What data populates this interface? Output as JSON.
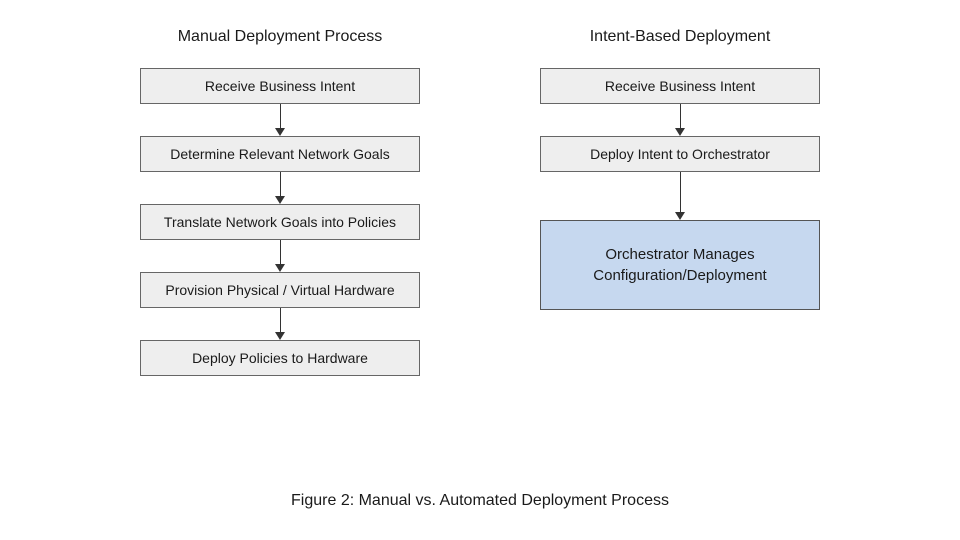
{
  "left": {
    "title": "Manual Deployment Process",
    "steps": [
      "Receive Business Intent",
      "Determine Relevant Network Goals",
      "Translate Network Goals into Policies",
      "Provision Physical / Virtual Hardware",
      "Deploy Policies to Hardware"
    ]
  },
  "right": {
    "title": "Intent-Based Deployment",
    "steps": [
      "Receive Business Intent",
      "Deploy Intent to Orchestrator"
    ],
    "final": "Orchestrator Manages Configuration/Deployment"
  },
  "caption": "Figure 2: Manual vs. Automated Deployment Process"
}
